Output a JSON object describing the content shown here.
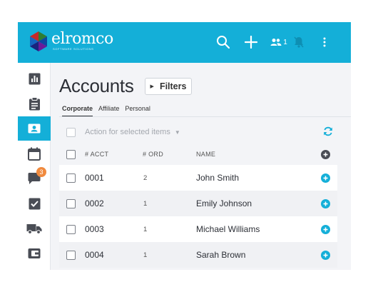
{
  "brand": {
    "name": "elromco",
    "tagline": "SOFTWARE SOLUTIONS",
    "colors": {
      "header": "#14afd8",
      "accent": "#14afd8",
      "badge": "#f08a3e"
    }
  },
  "header": {
    "search_icon": "search-icon",
    "add_icon": "plus-icon",
    "users_count": "1",
    "bell_icon": "bell-slash-icon",
    "more_icon": "kebab-menu-icon"
  },
  "sidebar": {
    "items": [
      {
        "icon": "bar-chart-icon",
        "active": false
      },
      {
        "icon": "clipboard-icon",
        "active": false
      },
      {
        "icon": "contact-card-icon",
        "active": true
      },
      {
        "icon": "calendar-icon",
        "active": false
      },
      {
        "icon": "chat-icon",
        "active": false,
        "badge": "3"
      },
      {
        "icon": "checkbox-icon",
        "active": false
      },
      {
        "icon": "truck-icon",
        "active": false
      },
      {
        "icon": "wallet-icon",
        "active": false
      }
    ]
  },
  "page": {
    "title": "Accounts",
    "filters_label": "Filters"
  },
  "tabs": [
    {
      "label": "Corporate",
      "active": true
    },
    {
      "label": "Affiliate",
      "active": false
    },
    {
      "label": "Personal",
      "active": false
    }
  ],
  "actions": {
    "placeholder": "Action for selected items",
    "refresh_icon": "refresh-icon"
  },
  "table": {
    "columns": [
      "# ACCT",
      "# ORD",
      "NAME"
    ],
    "rows": [
      {
        "acct": "0001",
        "ord": "2",
        "name": "John Smith"
      },
      {
        "acct": "0002",
        "ord": "1",
        "name": "Emily Johnson"
      },
      {
        "acct": "0003",
        "ord": "1",
        "name": "Michael Williams"
      },
      {
        "acct": "0004",
        "ord": "1",
        "name": "Sarah Brown"
      }
    ]
  }
}
